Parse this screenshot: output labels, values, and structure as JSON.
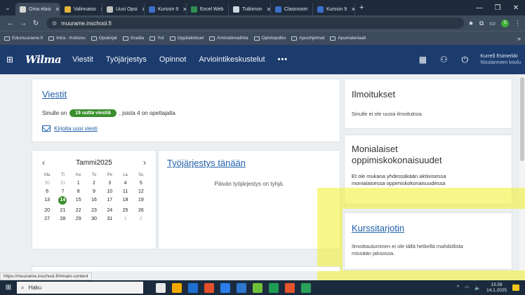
{
  "browser": {
    "tabs": [
      {
        "label": "Oma elasi",
        "color": "#d6d6d6",
        "active": true
      },
      {
        "label": "Valinnaiso",
        "color": "#e2b43a"
      },
      {
        "label": "Uusi Opoi",
        "color": "#bfbfbf"
      },
      {
        "label": "Kurssin 9",
        "color": "#3a70c9"
      },
      {
        "label": "Excel Web",
        "color": "#2f8f4f"
      },
      {
        "label": "Tutkimon",
        "color": "#cfd7e0"
      },
      {
        "label": "Classroom",
        "color": "#3a70c9"
      },
      {
        "label": "Kurssin 9",
        "color": "#3a70c9"
      }
    ],
    "new_tab": "+",
    "url": "muurame.inschool.fi",
    "bookmarks": [
      "Edumuurame.fi",
      "Intra - Kotisivu",
      "Opokirjat",
      "Gradia",
      "Yut",
      "Oppilaitokset",
      "Ammatinvalinta",
      "Opintopolku",
      "Apuohjelmat",
      "Apumateriaali"
    ],
    "bookmarks_more": "»",
    "profile_initial": "S",
    "status_url": "https://muurame.inschool.fi/#main-content"
  },
  "app": {
    "logo": "Wilma",
    "menu": [
      "Viestit",
      "Työjärjestys",
      "Opinnot",
      "Arviointikeskustelut",
      "•••"
    ],
    "user_name": "Kurre§ Esimerkki",
    "user_role": "Nisulannoen koulu"
  },
  "viestit": {
    "title": "Viestit",
    "prefix": "Sinulle on",
    "badge": "19 uutta viestiä",
    "suffix": ", joista 4 on opettajalta",
    "write_link": "Kirjoita uusi viesti"
  },
  "calendar": {
    "month": "Tammi2025",
    "prev": "‹",
    "next": "›",
    "day_headers": [
      "Ma",
      "Ti",
      "Ke",
      "To",
      "Pe",
      "La",
      "Su"
    ],
    "weeks": [
      [
        "30",
        "31",
        "1",
        "2",
        "3",
        "4",
        "5"
      ],
      [
        "6",
        "7",
        "8",
        "9",
        "10",
        "11",
        "12"
      ],
      [
        "13",
        "14",
        "15",
        "16",
        "17",
        "18",
        "19"
      ],
      [
        "20",
        "21",
        "22",
        "23",
        "24",
        "25",
        "26"
      ],
      [
        "27",
        "28",
        "29",
        "30",
        "31",
        "1",
        "2"
      ]
    ],
    "today": "14"
  },
  "tyojarjestys": {
    "title": "Työjärjestys tänään",
    "empty": "Päivän työjärjestys on tyhjä."
  },
  "ilmoitukset": {
    "title": "Ilmoitukset",
    "text": "Sinulle ei ole uusia ilmoituksia."
  },
  "monialaiset": {
    "title_line1": "Monialaiset",
    "title_line2": "oppimiskokonaisuudet",
    "text_line1": "Et ole mukana yhdessäkään aktiivisessa",
    "text_line2": "monialaisessa oppimiskokonaisuudessa"
  },
  "kurssitarjotin": {
    "title": "Kurssitarjotin",
    "text_line1": "Ilmoittautuminen ei ole tällä hetkellä mahdollista",
    "text_line2": "missään jaksossa."
  },
  "taskbar": {
    "search": "Haku",
    "time": "13.58",
    "date": "14.1.2025",
    "apps": [
      "#e8e8e8",
      "#f2a900",
      "#1f6fd1",
      "#e3502b",
      "#2b7de9",
      "#2e77d0",
      "#6fbf3a",
      "#1f9d55",
      "#e5532d",
      "#2aa05a"
    ]
  }
}
